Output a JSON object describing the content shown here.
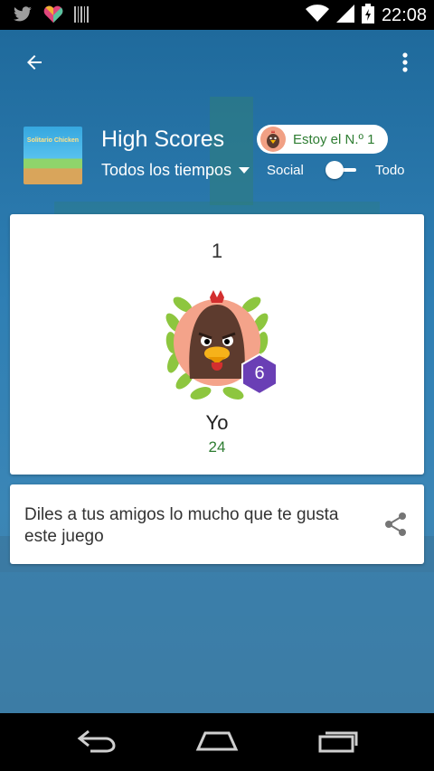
{
  "status_bar": {
    "time": "22:08",
    "icons": [
      "twitter-icon",
      "heart-icon",
      "barcode-icon",
      "wifi-icon",
      "signal-icon",
      "battery-icon"
    ]
  },
  "toolbar": {
    "back_icon": "arrow-back-icon",
    "menu_icon": "more-vert-icon"
  },
  "header": {
    "game_thumbnail_text": "Solitario Chicken",
    "title": "High Scores",
    "filter_label": "Todos los tiempos",
    "chip_label": "Estoy el N.º 1",
    "switch_left_label": "Social",
    "switch_right_label": "Todo"
  },
  "score_card": {
    "rank": "1",
    "level": "6",
    "player_name": "Yo",
    "score": "24"
  },
  "share_card": {
    "text": "Diles a tus amigos lo mucho que te gusta este juego",
    "icon": "share-icon"
  },
  "nav_bar": {
    "icons": [
      "back-icon",
      "home-icon",
      "recents-icon"
    ]
  },
  "colors": {
    "accent_green": "#2e7d32",
    "badge_purple": "#6a3fb5",
    "background_blue": "#3f86b8"
  }
}
